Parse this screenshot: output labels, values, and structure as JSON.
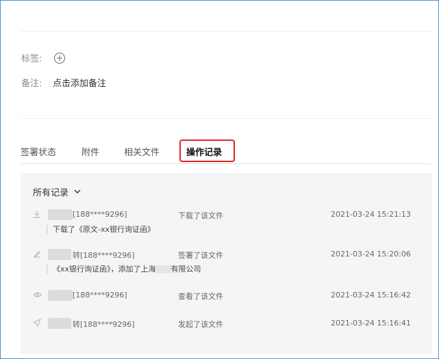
{
  "meta": {
    "tags_label": "标签:",
    "remark_label": "备注:",
    "remark_value": "点击添加备注"
  },
  "tabs": [
    {
      "label": "签署状态",
      "active": false
    },
    {
      "label": "附件",
      "active": false
    },
    {
      "label": "相关文件",
      "active": false
    },
    {
      "label": "操作记录",
      "active": true
    }
  ],
  "filter": {
    "label": "所有记录"
  },
  "records": [
    {
      "icon": "download-icon",
      "user": "[188****9296]",
      "action": "下载了该文件",
      "time": "2021-03-24 15:21:13",
      "detail": "下载了《原文-xx银行询证函》"
    },
    {
      "icon": "sign-icon",
      "user": "转[188****9296]",
      "action": "签署了该文件",
      "time": "2021-03-24 15:20:06",
      "detail": "《xx银行询证函》，添加了上海",
      "detail_tail": "有限公司"
    },
    {
      "icon": "eye-icon",
      "user": "[188****9296]",
      "action": "查看了该文件",
      "time": "2021-03-24 15:16:42"
    },
    {
      "icon": "send-icon",
      "user": "转[188****9296]",
      "action": "发起了该文件",
      "time": "2021-03-24 15:16:41"
    }
  ],
  "colors": {
    "highlight": "#e0241c",
    "frame": "#4a90e2",
    "panel_bg": "#f4f5f6"
  }
}
